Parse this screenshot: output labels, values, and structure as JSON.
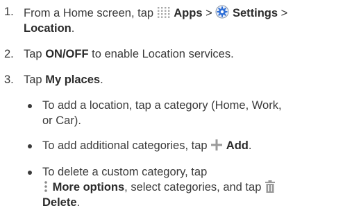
{
  "steps": [
    {
      "number": "1.",
      "line1_a": "From a Home screen, tap",
      "apps_label": "Apps",
      "sep1": ">",
      "settings_label": "Settings",
      "sep2": ">",
      "location_label": "Location",
      "location_suffix": "."
    },
    {
      "number": "2.",
      "text_a": "Tap",
      "onoff_label": "ON/OFF",
      "text_b": "to enable Location services."
    },
    {
      "number": "3.",
      "text_a": "Tap",
      "myplaces_label": "My places",
      "text_b": "."
    }
  ],
  "bullets": [
    {
      "line1": "To add a location, tap a category (Home, Work,",
      "line2": "or Car)."
    },
    {
      "text_a": "To add additional categories, tap",
      "add_label": "Add",
      "text_b": "."
    },
    {
      "line1": "To delete a custom category, tap",
      "more_label": "More options",
      "line2_b": ", select categories, and tap",
      "delete_label": "Delete",
      "line3_b": "."
    }
  ],
  "icons": {
    "apps": "apps-grid-icon",
    "settings": "settings-gear-icon",
    "add": "add-plus-icon",
    "more": "more-options-icon",
    "delete": "trash-icon"
  },
  "colors": {
    "text": "#3a3a3a",
    "icon_gray": "#9a9a9a",
    "settings_blue": "#2f6fd6"
  }
}
